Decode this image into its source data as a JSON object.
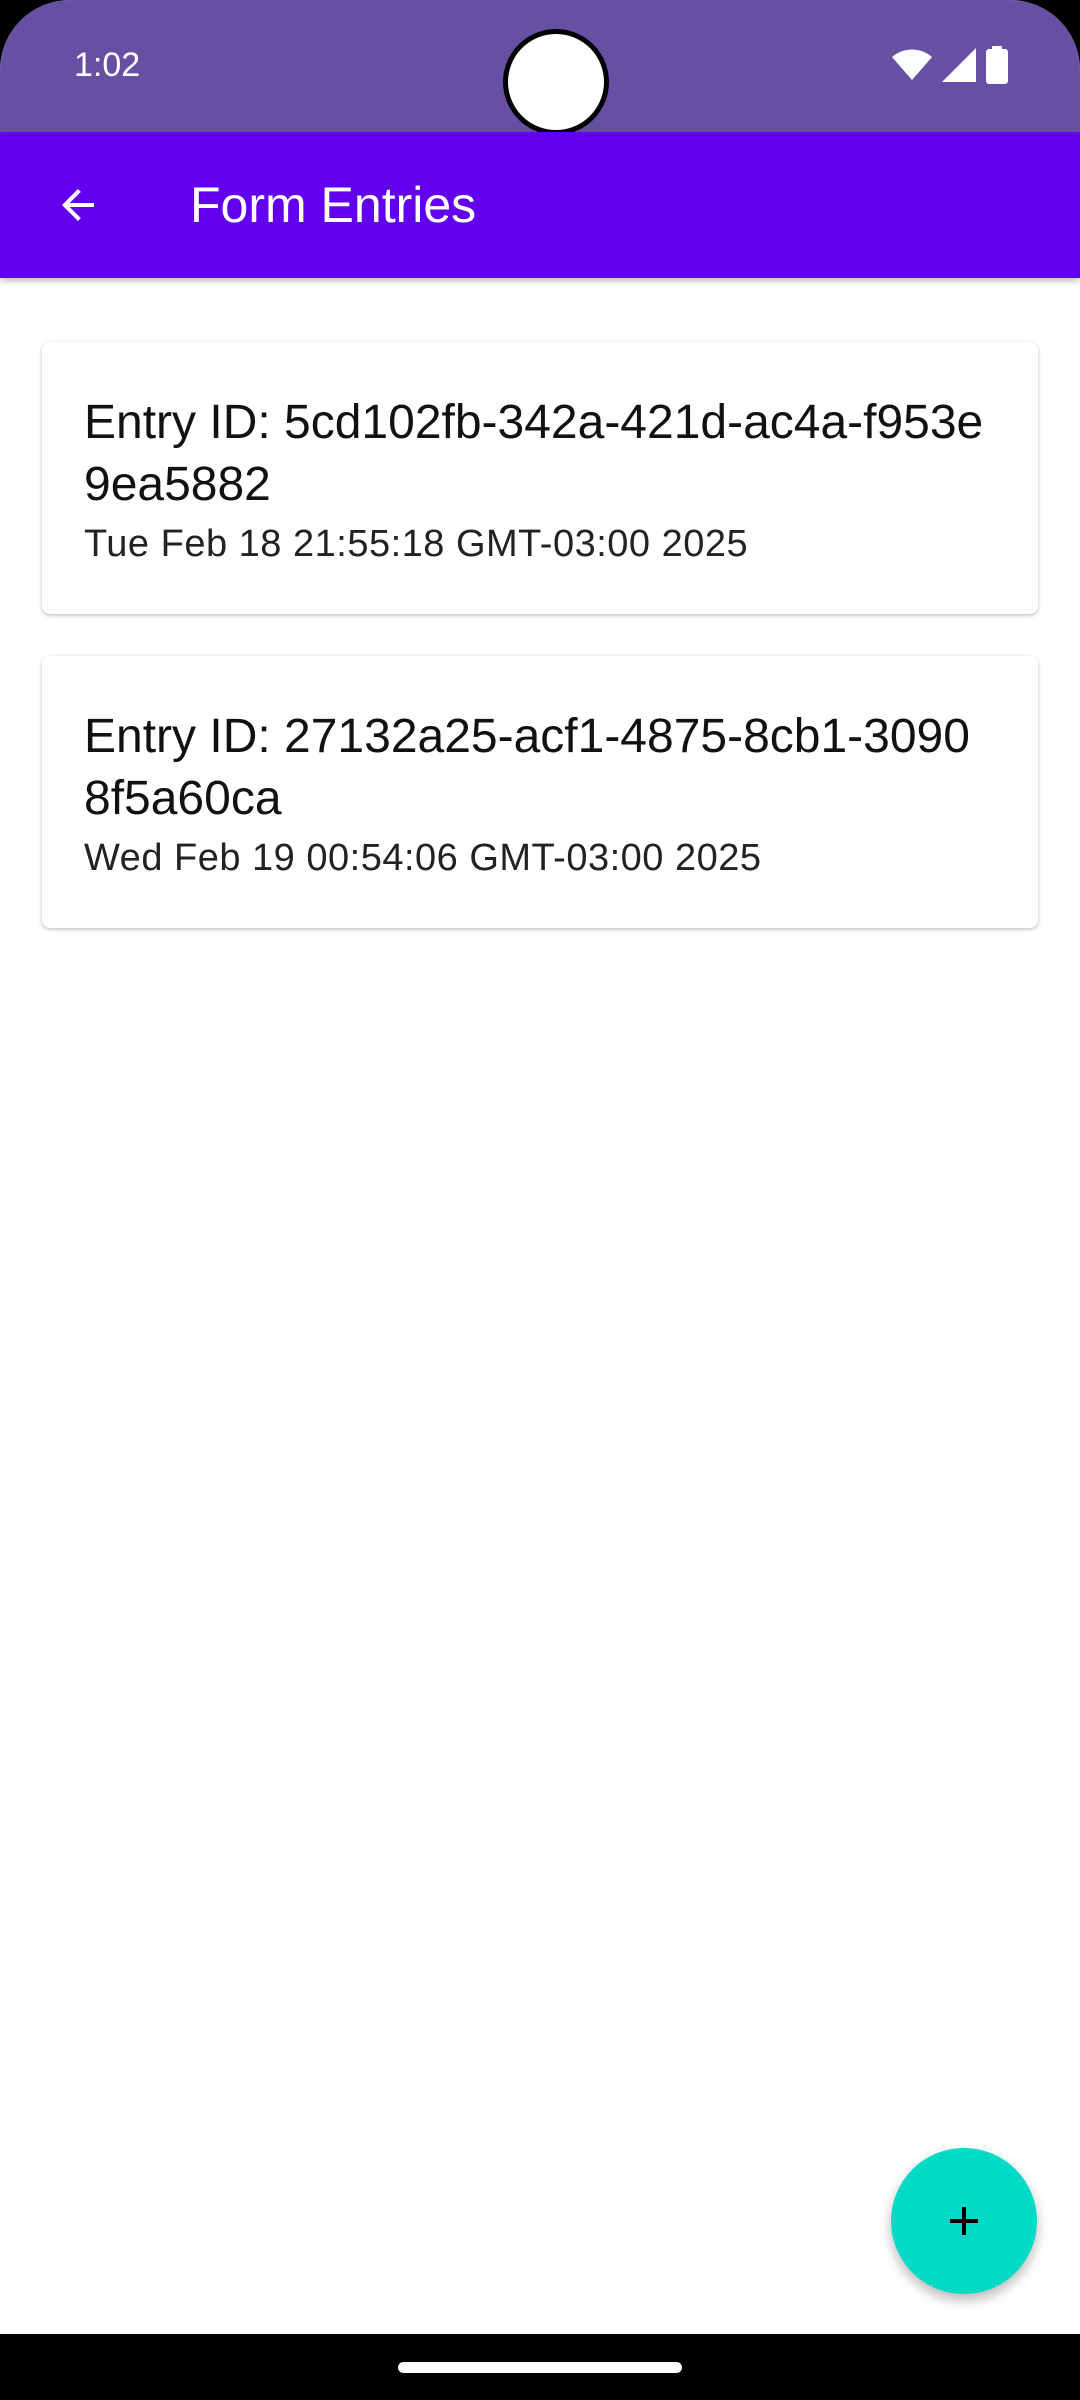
{
  "status_bar": {
    "time": "1:02",
    "background": "#6750a4",
    "icons": [
      "wifi-icon",
      "signal-icon",
      "battery-icon"
    ]
  },
  "app_bar": {
    "title": "Form Entries",
    "background": "#6200ee",
    "back_icon": "arrow-back-icon"
  },
  "entries": [
    {
      "id_line": "Entry ID: 5cd102fb-342a-421d-ac4a-f953e9ea5882",
      "date": "Tue Feb 18 21:55:18 GMT-03:00 2025"
    },
    {
      "id_line": "Entry ID: 27132a25-acf1-4875-8cb1-30908f5a60ca",
      "date": "Wed Feb 19 00:54:06 GMT-03:00 2025"
    }
  ],
  "fab": {
    "icon": "plus-icon",
    "background": "#03dac5"
  }
}
